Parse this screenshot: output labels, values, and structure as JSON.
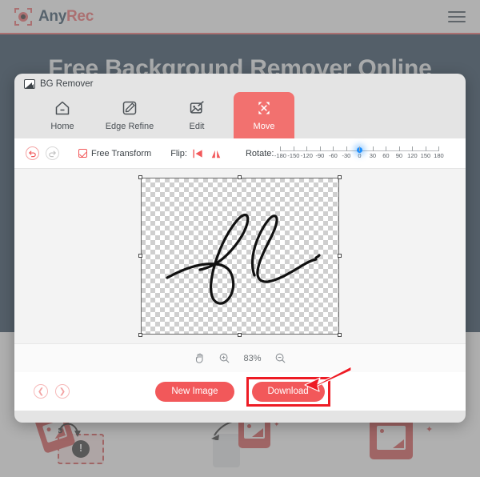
{
  "site": {
    "brand_any": "Any",
    "brand_rec": "Rec",
    "menu_icon": "hamburger-icon",
    "hero_title": "Free Background Remover Online"
  },
  "modal": {
    "title": "BG Remover",
    "title_icon": "image-icon",
    "tabs": [
      {
        "label": "Home",
        "icon": "home-icon",
        "active": false
      },
      {
        "label": "Edge Refine",
        "icon": "pen-edit-icon",
        "active": false
      },
      {
        "label": "Edit",
        "icon": "image-edit-icon",
        "active": false
      },
      {
        "label": "Move",
        "icon": "move-arrows-icon",
        "active": true
      }
    ],
    "toolbar": {
      "undo_icon": "undo-arrow-icon",
      "redo_icon": "redo-arrow-icon",
      "free_transform_label": "Free Transform",
      "free_transform_checked": true,
      "flip_label": "Flip:",
      "flip_horizontal_icon": "flip-horizontal-icon",
      "flip_vertical_icon": "flip-vertical-icon",
      "rotate_label": "Rotate:",
      "rotate_value": 0,
      "rotate_min": -180,
      "rotate_max": 180,
      "rotate_ticks": [
        -180,
        -150,
        -120,
        -90,
        -60,
        -30,
        0,
        30,
        60,
        90,
        120,
        150,
        180
      ]
    },
    "canvas": {
      "image_alt": "fl-signature",
      "transparent_background": true
    },
    "zoombar": {
      "hand_icon": "hand-icon",
      "zoom_in_icon": "zoom-in-icon",
      "zoom_out_icon": "zoom-out-icon",
      "zoom_level": "83%"
    },
    "footer": {
      "prev_icon": "chevron-left-icon",
      "next_icon": "chevron-right-icon",
      "new_image_label": "New Image",
      "download_label": "Download"
    }
  },
  "annotation": {
    "highlight_color": "#ee1c25",
    "arrow_icon": "pointer-arrow-icon",
    "target": "download-button"
  },
  "theme": {
    "accent": "#f2585a",
    "active_tab": "#f2716f",
    "hero_bg": "#0e2c45",
    "modal_bg": "#e4e4e4",
    "slider_knob": "#1e90ff"
  }
}
